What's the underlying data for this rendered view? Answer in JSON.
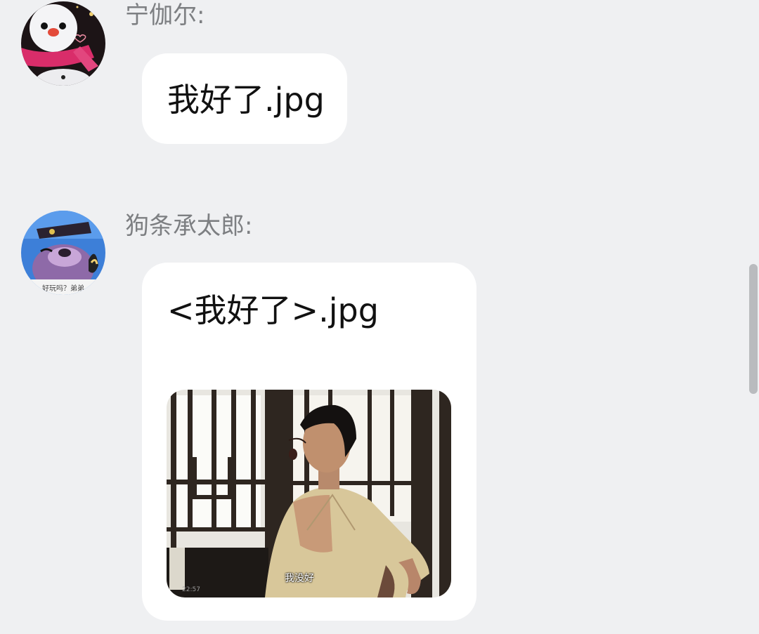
{
  "messages": [
    {
      "sender": "宁伽尔:",
      "avatar": "snowman-avatar",
      "text": "我好了.jpg"
    },
    {
      "sender": "狗条承太郎:",
      "avatar": "cartoon-bear-avatar",
      "avatar_caption": "好玩吗？弟弟",
      "text": "<我好了>.jpg",
      "image": {
        "subtitle": "我没好",
        "timestamp": "22:57"
      }
    }
  ],
  "colors": {
    "background": "#eff0f2",
    "bubble": "#ffffff",
    "sender_name": "#7d7f82",
    "message_text": "#111111",
    "scrollbar": "#b9bbbe"
  }
}
